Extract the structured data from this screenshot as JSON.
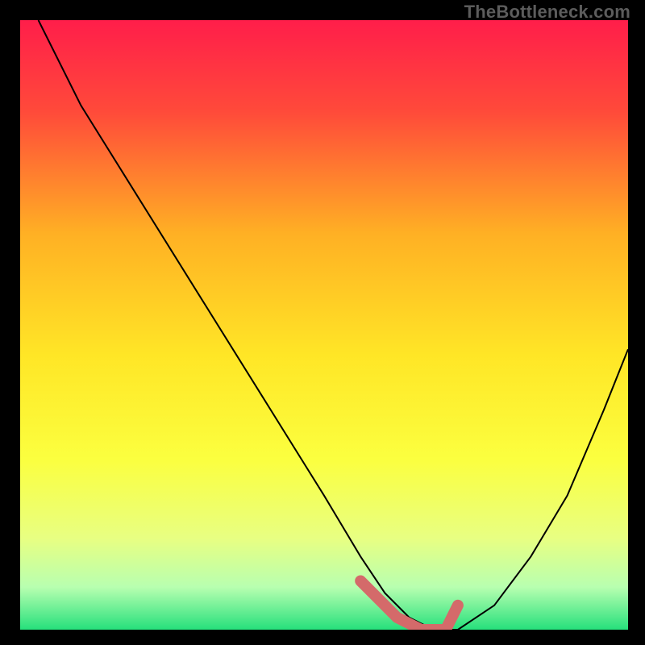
{
  "watermark": "TheBottleneck.com",
  "chart_data": {
    "type": "line",
    "title": "",
    "xlabel": "",
    "ylabel": "",
    "xlim": [
      0,
      100
    ],
    "ylim": [
      0,
      100
    ],
    "grid": false,
    "legend": false,
    "series": [
      {
        "name": "curve",
        "x": [
          3,
          10,
          20,
          30,
          40,
          50,
          56,
          60,
          64,
          68,
          72,
          78,
          84,
          90,
          96,
          100
        ],
        "y": [
          100,
          86,
          70,
          54,
          38,
          22,
          12,
          6,
          2,
          0,
          0,
          4,
          12,
          22,
          36,
          46
        ],
        "color": "#000000",
        "stroke_width": 2
      }
    ],
    "highlight": {
      "name": "min-zone",
      "x": [
        56,
        62,
        66,
        70,
        72
      ],
      "y": [
        8,
        2,
        0,
        0,
        4
      ],
      "color": "#d46a6a",
      "stroke_width": 14
    },
    "gradient_stops": [
      {
        "offset": 0.0,
        "color": "#ff1e4a"
      },
      {
        "offset": 0.15,
        "color": "#ff4a3a"
      },
      {
        "offset": 0.35,
        "color": "#ffb024"
      },
      {
        "offset": 0.55,
        "color": "#ffe626"
      },
      {
        "offset": 0.72,
        "color": "#fbff3f"
      },
      {
        "offset": 0.85,
        "color": "#e8ff82"
      },
      {
        "offset": 0.93,
        "color": "#b8ffb0"
      },
      {
        "offset": 1.0,
        "color": "#26e07c"
      }
    ]
  }
}
